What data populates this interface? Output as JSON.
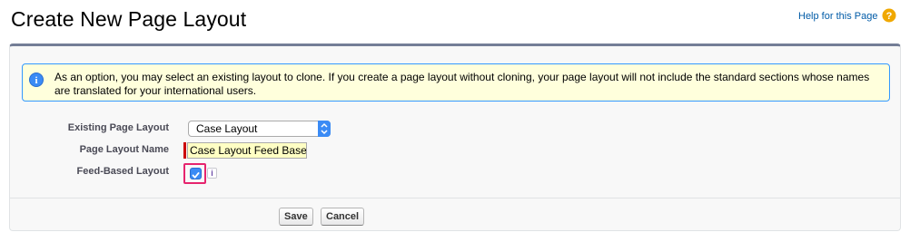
{
  "header": {
    "title": "Create New Page Layout",
    "help_link": "Help for this Page"
  },
  "info": {
    "message": "As an option, you may select an existing layout to clone. If you create a page layout without cloning, your page layout will not include the standard sections whose names are translated for your international users."
  },
  "form": {
    "existing_layout_label": "Existing Page Layout",
    "existing_layout_value": "Case Layout",
    "layout_name_label": "Page Layout Name",
    "layout_name_value": "Case Layout Feed Based",
    "feed_based_label": "Feed-Based Layout",
    "feed_based_checked": true,
    "info_badge": "i"
  },
  "buttons": {
    "save": "Save",
    "cancel": "Cancel"
  },
  "colors": {
    "help_icon": "#f0a800",
    "info_icon": "#3b8bf5",
    "required": "#cc0000",
    "highlight": "#e6246e"
  }
}
